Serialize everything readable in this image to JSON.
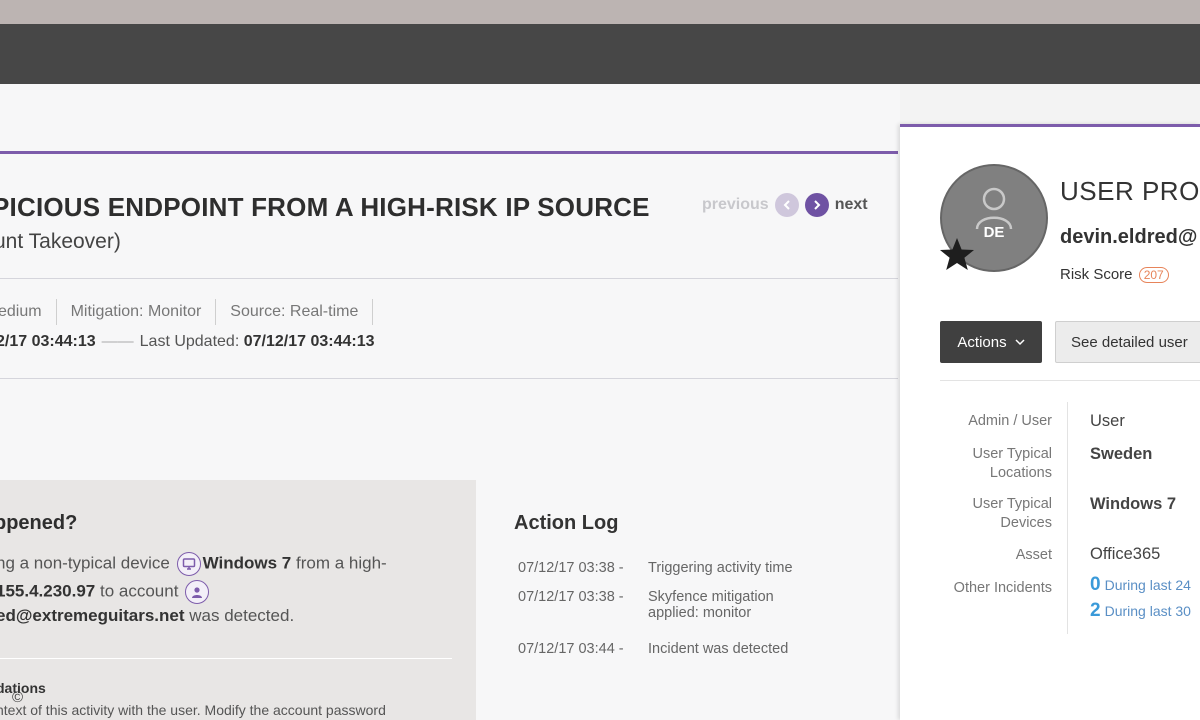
{
  "incident": {
    "title": "PICIOUS ENDPOINT FROM A HIGH-RISK IP SOURCE",
    "subtitle": "unt Takeover)",
    "pager": {
      "previous": "previous",
      "next": "next"
    },
    "meta": {
      "severity": "edium",
      "mitigation": "Mitigation: Monitor",
      "source": "Source: Real-time"
    },
    "dates": {
      "created": "2/17 03:44:13",
      "last_updated_label": "Last Updated:",
      "last_updated": "07/12/17 03:44:13"
    }
  },
  "what_happened": {
    "heading": "ppened?",
    "line1_pre": "ng a non-typical device",
    "device": "Windows 7",
    "line1_post": "from a high-",
    "ip": "155.4.230.97",
    "line2_post": "to account",
    "account": "ed@extremeguitars.net",
    "line3_post": "was detected.",
    "rec_title": "dations",
    "rec_text": "ntext of this activity with the user. Modify the account password"
  },
  "action_log": {
    "heading": "Action Log",
    "entries": [
      {
        "time": "07/12/17 03:38 -",
        "text": "Triggering activity time"
      },
      {
        "time": "07/12/17 03:38 -",
        "text": "Skyfence mitigation",
        "text2": "applied: monitor"
      },
      {
        "time": "07/12/17 03:44 -",
        "text": "Incident was detected"
      }
    ]
  },
  "profile": {
    "title": "USER PRO",
    "initials": "DE",
    "email": "devin.eldred@",
    "risk_label": "Risk Score",
    "risk_value": "207",
    "actions_label": "Actions",
    "detail_label": "See detailed user",
    "fields": {
      "role_label": "Admin / User",
      "role_value": "User",
      "loc_label1": "User Typical",
      "loc_label2": "Locations",
      "loc_value": "Sweden",
      "dev_label1": "User Typical",
      "dev_label2": "Devices",
      "dev_value": "Windows 7",
      "asset_label": "Asset",
      "asset_value": "Office365",
      "other_label": "Other Incidents",
      "other1_count": "0",
      "other1_text": "During last 24",
      "other2_count": "2",
      "other2_text": "During last 30"
    }
  },
  "footer": {
    "copyright": "©"
  },
  "colors": {
    "accent": "#7d5cab",
    "topbar": "#474747",
    "risk_badge": "#e7845a",
    "link": "#3a9ad9"
  }
}
